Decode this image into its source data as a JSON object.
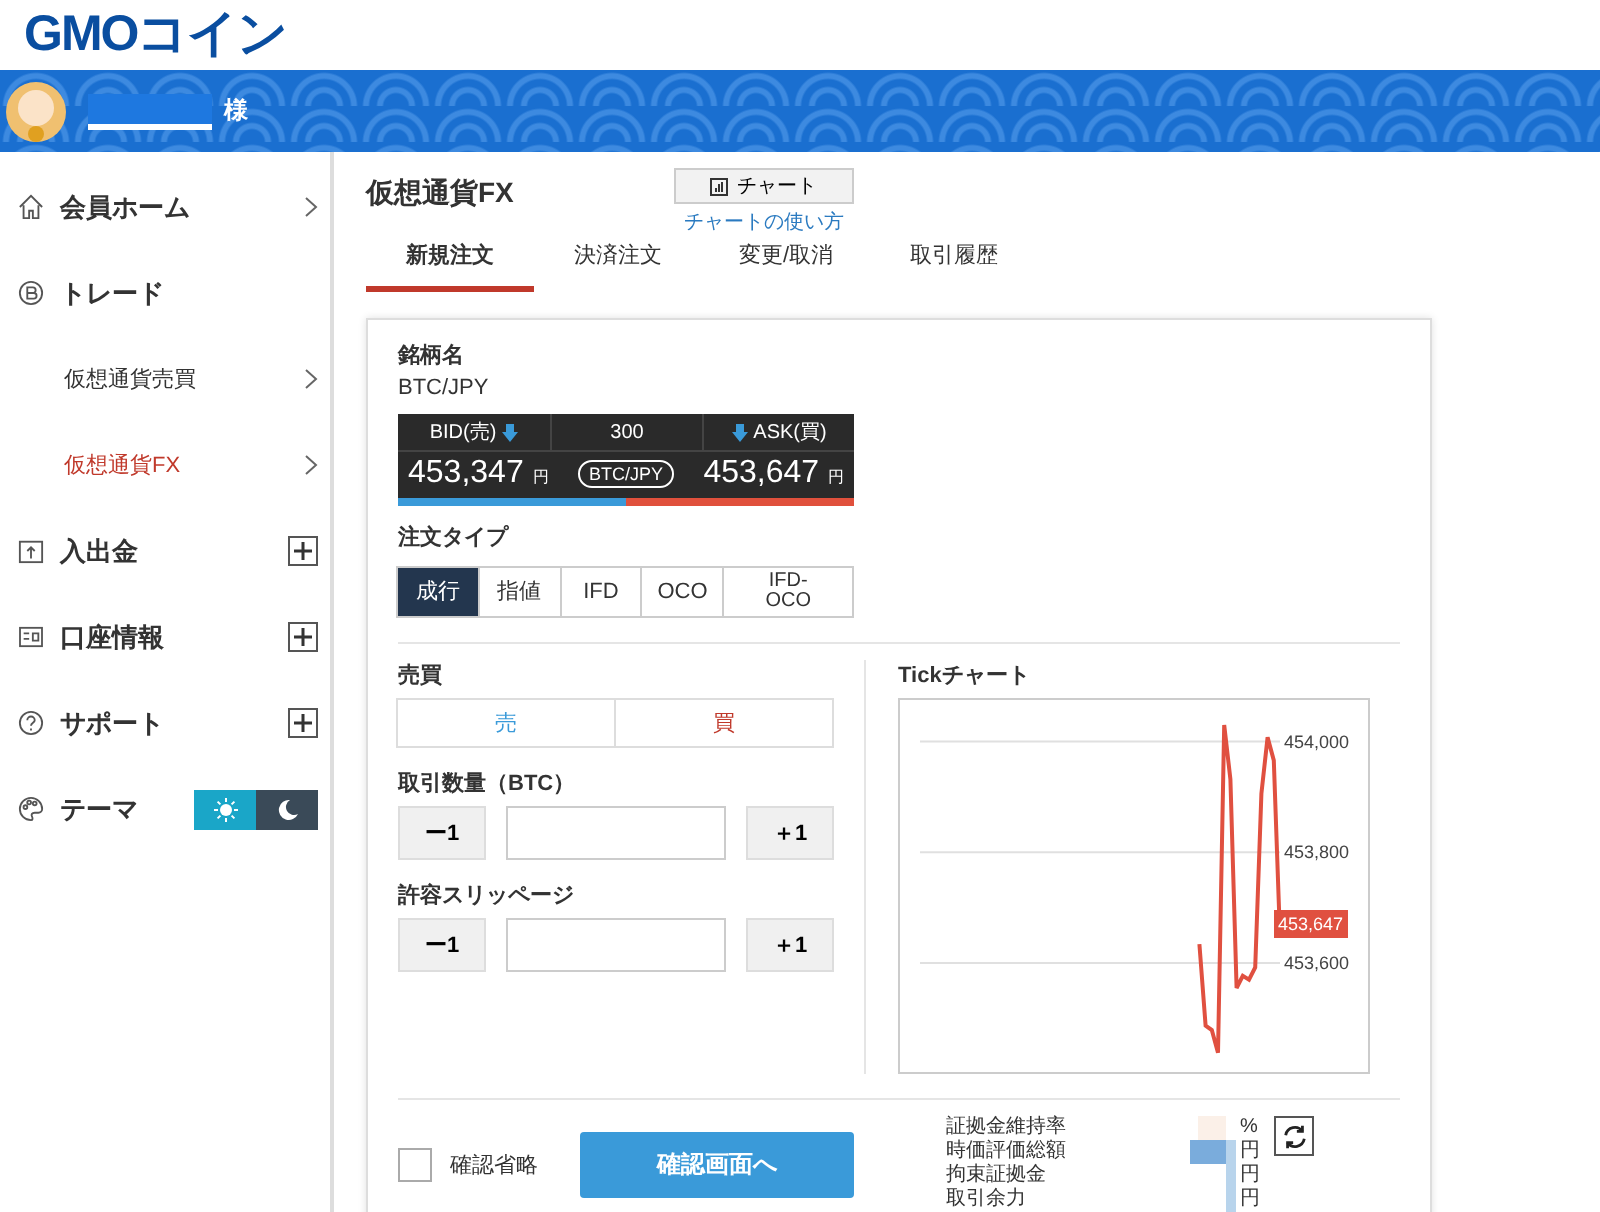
{
  "header": {
    "logo": "GMOコイン"
  },
  "user": {
    "honorific": "様"
  },
  "sidebar": {
    "items": [
      {
        "kind": "nav",
        "label": "会員ホーム",
        "selected": false
      },
      {
        "kind": "section",
        "label": "トレード",
        "selected": false
      },
      {
        "kind": "sub",
        "label": "仮想通貨売買",
        "selected": false
      },
      {
        "kind": "sub",
        "label": "仮想通貨FX",
        "selected": true
      },
      {
        "kind": "expand",
        "label": "入出金",
        "selected": false
      },
      {
        "kind": "expand",
        "label": "口座情報",
        "selected": false
      },
      {
        "kind": "expand",
        "label": "サポート",
        "selected": false
      },
      {
        "kind": "theme",
        "label": "テーマ",
        "selected": false,
        "light": true
      }
    ]
  },
  "page": {
    "title": "仮想通貨FX",
    "chart_button": "チャート",
    "chart_help_link": "チャートの使い方"
  },
  "tabs": [
    {
      "label": "新規注文",
      "selected": true
    },
    {
      "label": "決済注文",
      "selected": false
    },
    {
      "label": "変更/取消",
      "selected": false
    },
    {
      "label": "取引履歴",
      "selected": false
    }
  ],
  "order": {
    "symbol_label": "銘柄名",
    "symbol": "BTC/JPY",
    "ticker": {
      "bid_label": "BID(売)",
      "spread": "300",
      "ask_label": "ASK(買)",
      "bid": "453,347",
      "bid_unit": "円",
      "ask": "453,647",
      "ask_unit": "円",
      "pair": "BTC/JPY"
    },
    "order_type_label": "注文タイプ",
    "order_types": [
      {
        "label": "成行",
        "selected": true
      },
      {
        "label": "指値",
        "selected": false
      },
      {
        "label": "IFD",
        "selected": false
      },
      {
        "label": "OCO",
        "selected": false
      },
      {
        "label": "IFD-OCO",
        "selected": false
      }
    ],
    "side_label": "売買",
    "sides": [
      {
        "label": "売",
        "kind": "sell",
        "selected": false
      },
      {
        "label": "買",
        "kind": "buy",
        "selected": false
      }
    ],
    "steppers": [
      {
        "label": "取引数量（BTC）",
        "minus": "ー1",
        "plus": "＋1"
      },
      {
        "label": "許容スリッページ",
        "minus": "ー1",
        "plus": "＋1"
      }
    ],
    "skip_confirm": {
      "label": "確認省略",
      "checked": false
    },
    "confirm_button": "確認画面へ"
  },
  "tick_chart": {
    "title": "Tickチャート",
    "last_price": "453,647",
    "chart_data": {
      "type": "line",
      "grid": true,
      "ylim": [
        453396,
        454075
      ],
      "yticks": [
        {
          "value": 453600,
          "label": "453,600"
        },
        {
          "value": 453800,
          "label": "453,800"
        },
        {
          "value": 454000,
          "label": "454,000"
        }
      ],
      "series": [
        {
          "color": "#e05040",
          "values": [
            null,
            null,
            null,
            null,
            null,
            null,
            null,
            null,
            null,
            null,
            null,
            null,
            null,
            null,
            null,
            null,
            null,
            null,
            null,
            null,
            null,
            null,
            null,
            null,
            null,
            null,
            null,
            null,
            null,
            null,
            null,
            null,
            null,
            null,
            null,
            null,
            null,
            null,
            null,
            null,
            null,
            null,
            null,
            null,
            null,
            453634,
            453487,
            453479,
            453438,
            454030,
            453932,
            453555,
            453577,
            453570,
            453592,
            453906,
            454008,
            453966,
            453647
          ]
        }
      ]
    }
  },
  "summary": [
    {
      "label": "証拠金維持率",
      "unit": "%"
    },
    {
      "label": "時価評価総額",
      "unit": "円"
    },
    {
      "label": "拘束証拠金",
      "unit": "円"
    },
    {
      "label": "取引余力",
      "unit": "円"
    }
  ]
}
